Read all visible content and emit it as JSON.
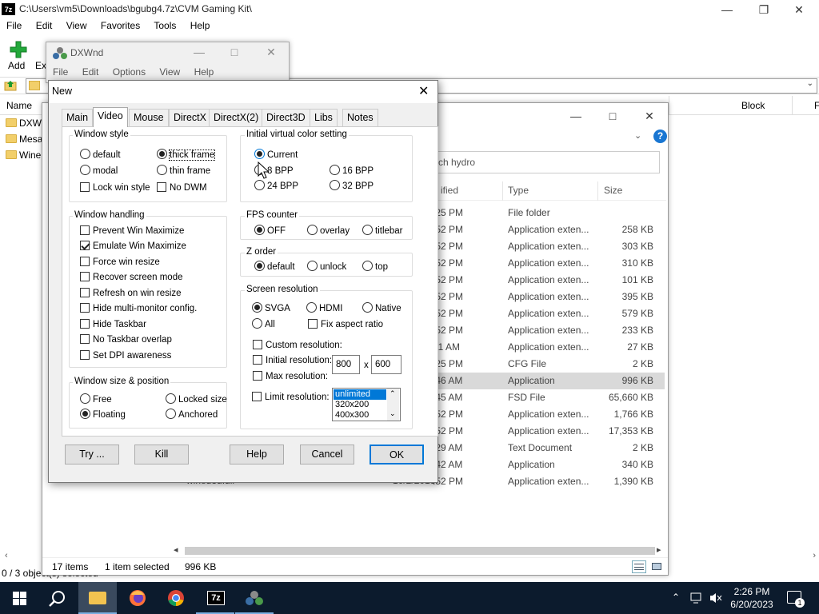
{
  "zip": {
    "title": "C:\\Users\\vm5\\Downloads\\bgubg4.7z\\CVM Gaming Kit\\",
    "app_icon": "7z",
    "menu": [
      "File",
      "Edit",
      "View",
      "Favorites",
      "Tools",
      "Help"
    ],
    "toolbar": {
      "add": "Add",
      "extract": "Ex"
    },
    "list_header": "Name",
    "list_items": [
      "DXWl",
      "Mesa",
      "Wine"
    ],
    "header_right": {
      "block": "Block",
      "f": "F"
    },
    "status": {
      "objects": "0 / 3 object(s) selected",
      "items": "17 items",
      "selected": "1 item selected",
      "size": "996 KB"
    }
  },
  "explorer": {
    "search_placeholder": "ch hydro",
    "columns": {
      "modified": "ified",
      "type": "Type",
      "size": "Size"
    },
    "rows": [
      {
        "date": ":25 PM",
        "type": "File folder",
        "size": ""
      },
      {
        "date": ":52 PM",
        "type": "Application exten...",
        "size": "258 KB"
      },
      {
        "date": ":52 PM",
        "type": "Application exten...",
        "size": "303 KB"
      },
      {
        "date": ":52 PM",
        "type": "Application exten...",
        "size": "310 KB"
      },
      {
        "date": ":52 PM",
        "type": "Application exten...",
        "size": "101 KB"
      },
      {
        "date": ":52 PM",
        "type": "Application exten...",
        "size": "395 KB"
      },
      {
        "date": ":52 PM",
        "type": "Application exten...",
        "size": "579 KB"
      },
      {
        "date": ":52 PM",
        "type": "Application exten...",
        "size": "233 KB"
      },
      {
        "date": "31 AM",
        "type": "Application exten...",
        "size": "27 KB"
      },
      {
        "date": ":25 PM",
        "type": "CFG File",
        "size": "2 KB"
      },
      {
        "date": ":46 AM",
        "type": "Application",
        "size": "996 KB"
      },
      {
        "date": ":45 AM",
        "type": "FSD File",
        "size": "65,660 KB"
      },
      {
        "date": ":52 PM",
        "type": "Application exten...",
        "size": "1,766 KB"
      },
      {
        "date": ":52 PM",
        "type": "Application exten...",
        "size": "17,353 KB"
      },
      {
        "date": ":29 AM",
        "type": "Text Document",
        "size": "2 KB"
      },
      {
        "date": ":42 AM",
        "type": "Application",
        "size": "340 KB"
      },
      {
        "date": ":52 PM",
        "type": "Application exten...",
        "size": "1,390 KB"
      }
    ],
    "last_row_name": "wined3d.dll",
    "last_row_date": "10/2/2013"
  },
  "dxwnd": {
    "title": "DXWnd",
    "menu": [
      "File",
      "Edit",
      "Options",
      "View",
      "Help"
    ]
  },
  "dialog": {
    "title": "New",
    "tabs": [
      "Main",
      "Video",
      "Mouse",
      "DirectX",
      "DirectX(2)",
      "Direct3D",
      "Libs",
      "Notes"
    ],
    "window_style": {
      "label": "Window style",
      "default": "default",
      "thick_frame": "thick frame",
      "modal": "modal",
      "thin_frame": "thin frame",
      "lock_win_style": "Lock win style",
      "no_dwm": "No DWM"
    },
    "color": {
      "label": "Initial virtual color setting",
      "current": "Current",
      "bpp8": "8 BPP",
      "bpp16": "16 BPP",
      "bpp24": "24 BPP",
      "bpp32": "32 BPP"
    },
    "handling": {
      "label": "Window handling",
      "items": [
        "Prevent Win Maximize",
        "Emulate Win Maximize",
        "Force win resize",
        "Recover screen mode",
        "Refresh on win resize",
        "Hide multi-monitor config.",
        "Hide Taskbar",
        "No Taskbar overlap",
        "Set DPI awareness"
      ]
    },
    "fps": {
      "label": "FPS counter",
      "off": "OFF",
      "overlay": "overlay",
      "titlebar": "titlebar"
    },
    "zorder": {
      "label": "Z order",
      "default": "default",
      "unlock": "unlock",
      "top": "top"
    },
    "screen": {
      "label": "Screen resolution",
      "svga": "SVGA",
      "hdmi": "HDMI",
      "native": "Native",
      "all": "All",
      "fix_aspect": "Fix aspect ratio",
      "custom": "Custom resolution:",
      "initial": "Initial resolution:",
      "width": "800",
      "x": "x",
      "height": "600",
      "max": "Max resolution:",
      "limit": "Limit  resolution:",
      "list": [
        "unlimited",
        "320x200",
        "400x300"
      ]
    },
    "size_pos": {
      "label": "Window size & position",
      "free": "Free",
      "locked": "Locked size",
      "floating": "Floating",
      "anchored": "Anchored"
    },
    "buttons": {
      "try": "Try ...",
      "kill": "Kill",
      "help": "Help",
      "cancel": "Cancel",
      "ok": "OK"
    }
  },
  "taskbar": {
    "time": "2:26 PM",
    "date": "6/20/2023",
    "notif_count": "1",
    "app_7z": "7z"
  }
}
